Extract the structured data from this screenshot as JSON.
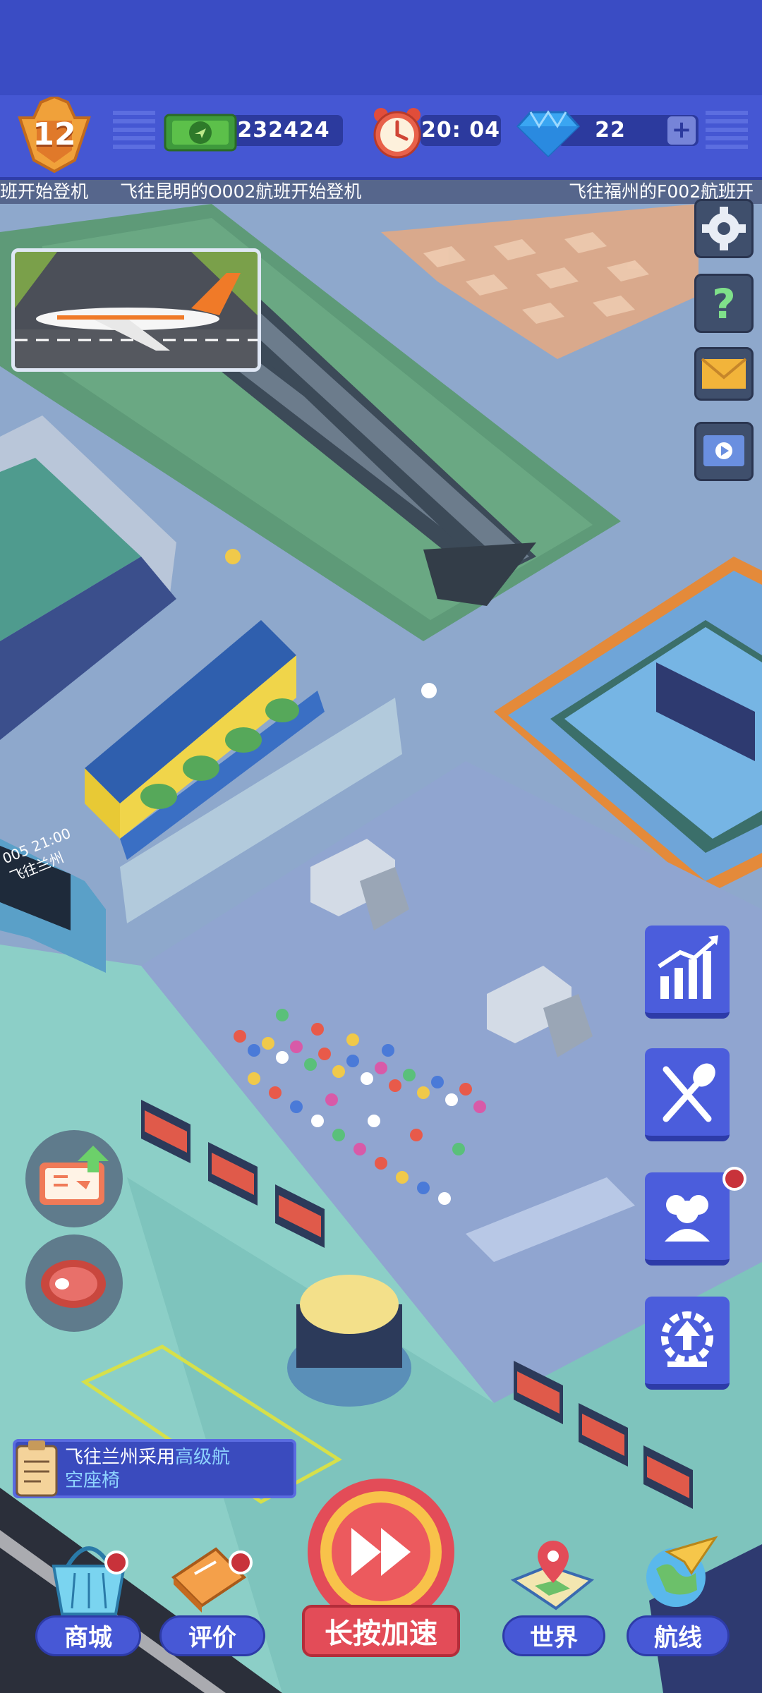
{
  "hud": {
    "level": "12",
    "cash": "232424",
    "time": "20: 04",
    "gems": "22"
  },
  "ticker": {
    "items": [
      "班开始登机",
      "飞往昆明的O002航班开始登机",
      "飞往福州的F002航班开"
    ]
  },
  "board_sign": {
    "line1": "005 21:00",
    "line2": "飞往兰州"
  },
  "task": {
    "prefix": "飞往兰州采用",
    "highlight": "高级航",
    "suffix": "空座椅"
  },
  "bottom_nav": {
    "shop": "商城",
    "rate": "评价",
    "speed": "长按加速",
    "world": "世界",
    "routes": "航线"
  },
  "colors": {
    "hud_bg": "#4557d3",
    "accent_red": "#e34c58",
    "button_blue": "#4b5ddc"
  }
}
